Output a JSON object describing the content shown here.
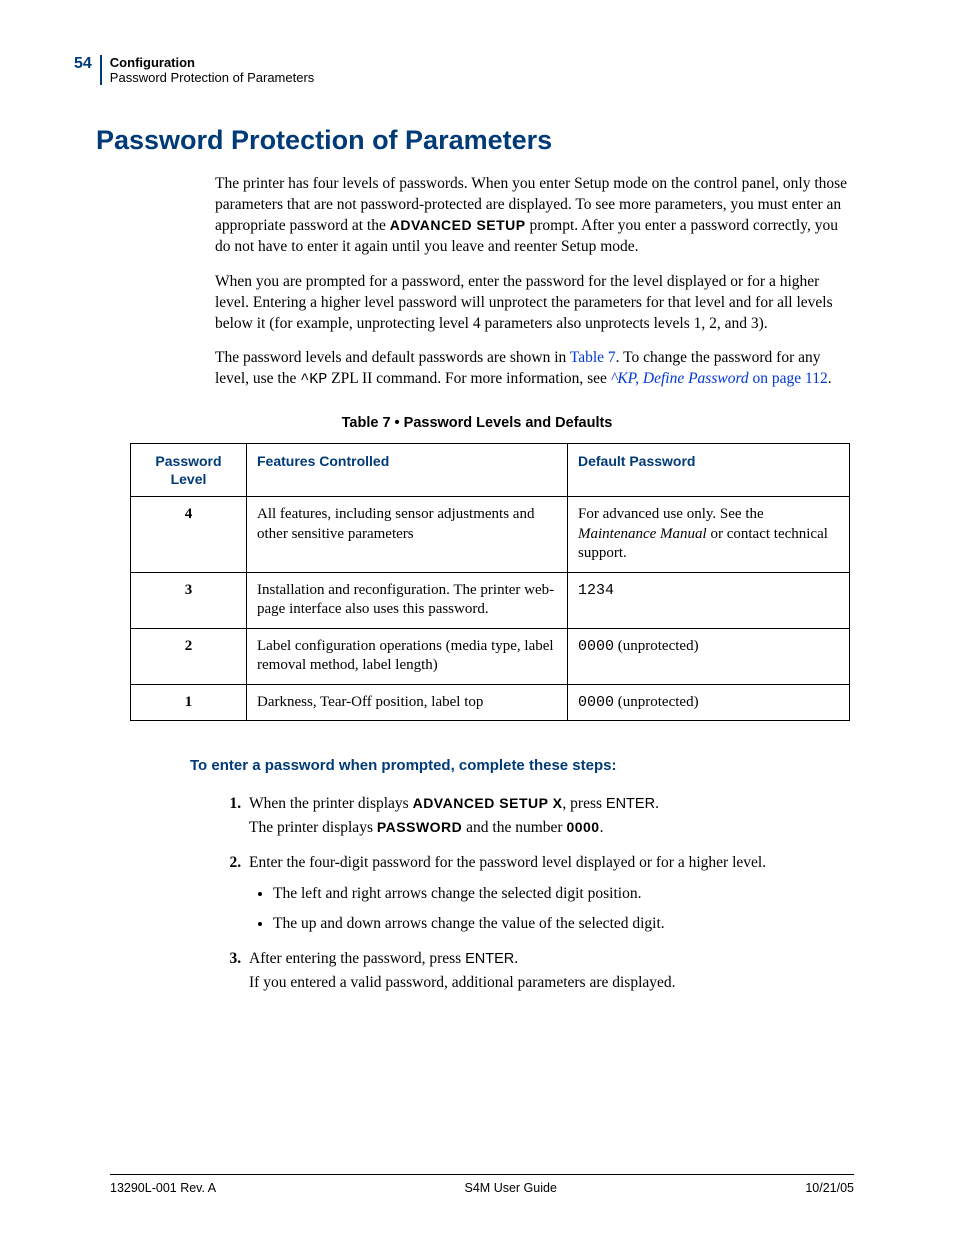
{
  "header": {
    "page_num": "54",
    "chapter": "Configuration",
    "section": "Password Protection of Parameters"
  },
  "title": "Password Protection of Parameters",
  "para1_a": "The printer has four levels of passwords. When you enter Setup mode on the control panel, only those parameters that are not password-protected are displayed. To see more parameters, you must enter an appropriate password at the ",
  "para1_lcd": "ADVANCED SETUP",
  "para1_b": " prompt. After you enter a password correctly, you do not have to enter it again until you leave and reenter Setup mode.",
  "para2": "When you are prompted for a password, enter the password for the level displayed or for a higher level. Entering a higher level password will unprotect the parameters for that level and for all levels below it (for example, unprotecting level 4 parameters also unprotects levels 1, 2, and 3).",
  "para3_a": "The password levels and default passwords are shown in ",
  "para3_link1": "Table 7",
  "para3_b": ". To change the password for any level, use the ",
  "para3_mono": "^KP",
  "para3_c": " ZPL II command. For more information, see ",
  "para3_link2": "^KP, Define Password",
  "para3_link3": "on page 112",
  "para3_d": ".",
  "table_caption": "Table 7 • Password Levels and Defaults",
  "table": {
    "h1": "Password Level",
    "h2": "Features Controlled",
    "h3": "Default Password",
    "rows": [
      {
        "level": "4",
        "features": "All features, including sensor adjustments and other sensitive parameters",
        "pwd_a": "For advanced use only. See the ",
        "pwd_i": "Maintenance Manual",
        "pwd_b": " or contact technical support."
      },
      {
        "level": "3",
        "features": "Installation and reconfiguration. The printer web-page interface also uses this password.",
        "pwd_mono": "1234",
        "pwd_b": ""
      },
      {
        "level": "2",
        "features": "Label configuration operations (media type, label removal method, label length)",
        "pwd_mono": "0000",
        "pwd_b": " (unprotected)"
      },
      {
        "level": "1",
        "features": "Darkness, Tear-Off position, label top",
        "pwd_mono": "0000",
        "pwd_b": " (unprotected)"
      }
    ]
  },
  "steps_heading": "To enter a password when prompted, complete these steps:",
  "step1_a": "When the printer displays ",
  "step1_lcd": "ADVANCED SETUP X",
  "step1_b": ", press ",
  "step1_sans": "ENTER",
  "step1_c": ".",
  "step1_d": "The printer displays ",
  "step1_lcd2": "PASSWORD",
  "step1_e": " and the number ",
  "step1_lcd3": "0000",
  "step1_f": ".",
  "step2": "Enter the four-digit password for the password level displayed or for a higher level.",
  "step2_sub1": "The left and right arrows change the selected digit position.",
  "step2_sub2": "The up and down arrows change the value of the selected digit.",
  "step3_a": "After entering the password, press ",
  "step3_sans": "ENTER",
  "step3_b": ".",
  "step3_c": "If you entered a valid password, additional parameters are displayed.",
  "footer": {
    "left": "13290L-001 Rev. A",
    "center": "S4M User Guide",
    "right": "10/21/05"
  }
}
